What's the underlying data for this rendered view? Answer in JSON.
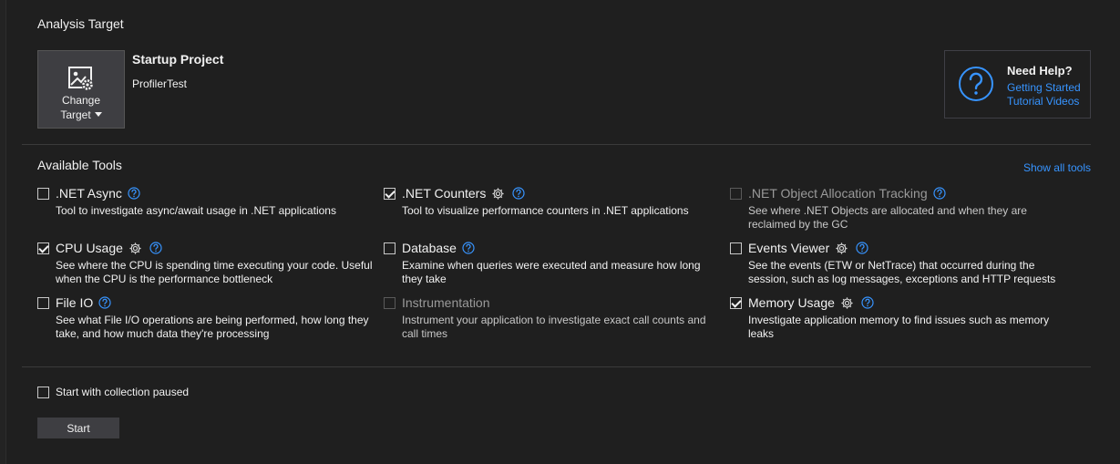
{
  "analysis_target": {
    "section_title": "Analysis Target",
    "change_target_line1": "Change",
    "change_target_line2": "Target",
    "startup_title": "Startup Project",
    "startup_name": "ProfilerTest"
  },
  "help": {
    "title": "Need Help?",
    "link1": "Getting Started",
    "link2": "Tutorial Videos"
  },
  "tools_section": {
    "title": "Available Tools",
    "show_all": "Show all tools",
    "tools": [
      {
        "name": ".NET Async",
        "desc": "Tool to investigate async/await usage in .NET applications",
        "checked": false,
        "enabled": true,
        "gear": false
      },
      {
        "name": ".NET Counters",
        "desc": "Tool to visualize performance counters in .NET applications",
        "checked": true,
        "enabled": true,
        "gear": true
      },
      {
        "name": ".NET Object Allocation Tracking",
        "desc": "See where .NET Objects are allocated and when they are reclaimed by the GC",
        "checked": false,
        "enabled": false,
        "gear": false
      },
      {
        "name": "CPU Usage",
        "desc": "See where the CPU is spending time executing your code. Useful when the CPU is the performance bottleneck",
        "checked": true,
        "enabled": true,
        "gear": true
      },
      {
        "name": "Database",
        "desc": "Examine when queries were executed and measure how long they take",
        "checked": false,
        "enabled": true,
        "gear": false
      },
      {
        "name": "Events Viewer",
        "desc": "See the events (ETW or NetTrace) that occurred during the session, such as log messages, exceptions and HTTP requests",
        "checked": false,
        "enabled": true,
        "gear": true
      },
      {
        "name": "File IO",
        "desc": "See what File I/O operations are being performed, how long they take, and how much data they're processing",
        "checked": false,
        "enabled": true,
        "gear": false
      },
      {
        "name": "Instrumentation",
        "desc": "Instrument your application to investigate exact call counts and call times",
        "checked": false,
        "enabled": false,
        "gear": false
      },
      {
        "name": "Memory Usage",
        "desc": "Investigate application memory to find issues such as memory leaks",
        "checked": true,
        "enabled": true,
        "gear": true
      }
    ]
  },
  "footer": {
    "paused_label": "Start with collection paused",
    "start_label": "Start"
  },
  "colors": {
    "background": "#1f1f1f",
    "link": "#3794ff",
    "button": "#3e3e42",
    "divider": "#3a3a3a"
  }
}
